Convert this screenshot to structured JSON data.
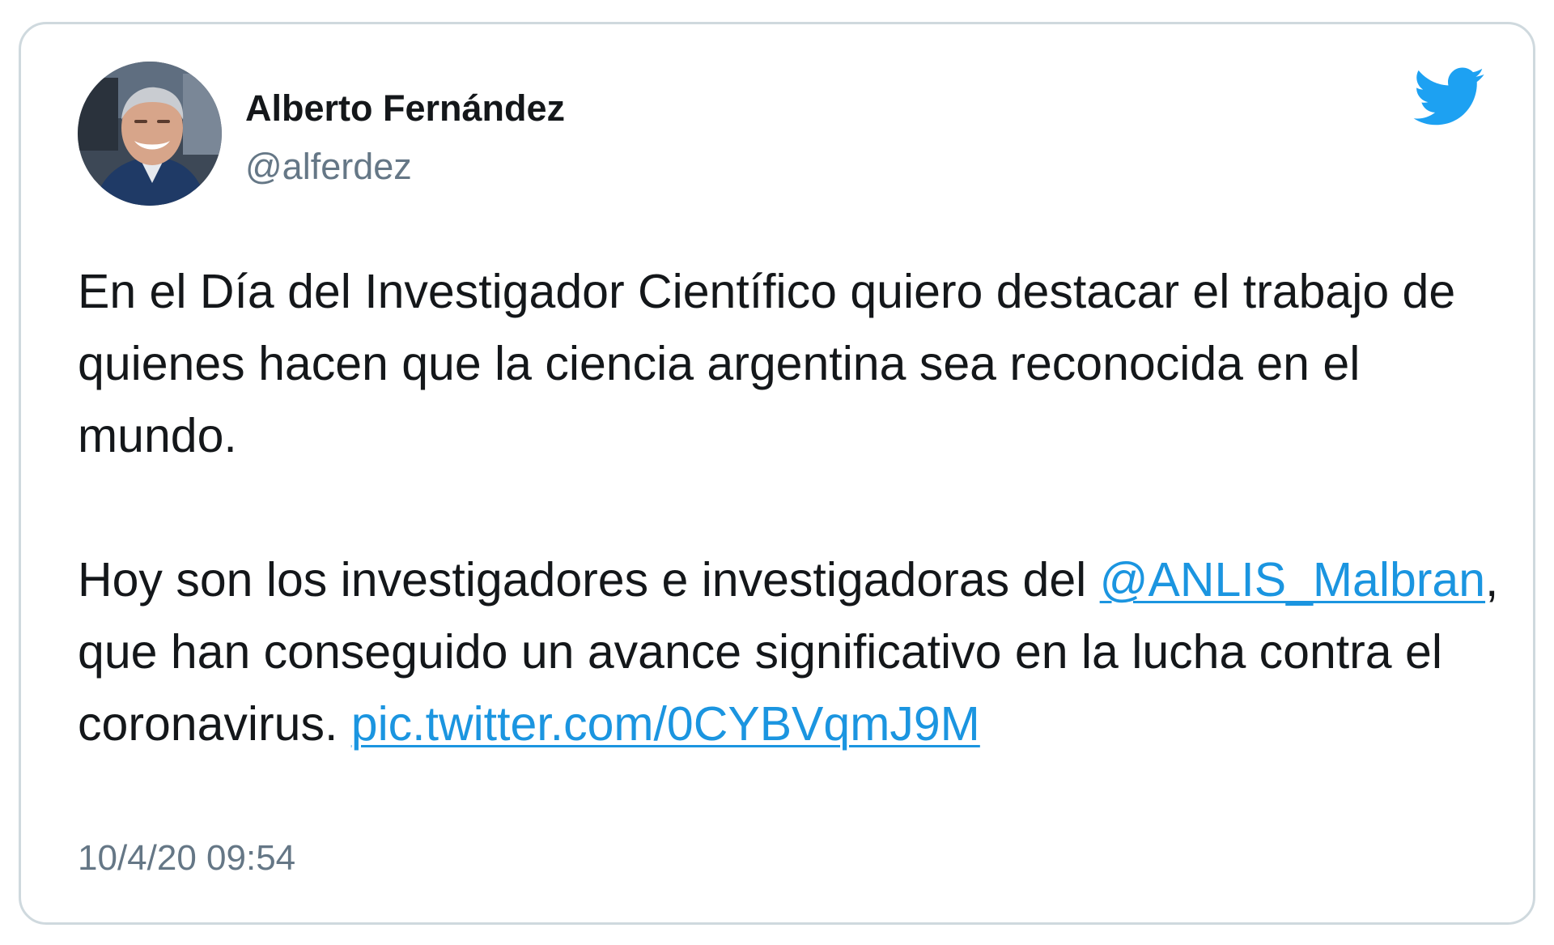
{
  "tweet": {
    "author": {
      "display_name": "Alberto Fernández",
      "handle": "@alferdez",
      "avatar_icon": "profile-photo-avatar"
    },
    "platform_icon": "twitter-bird-icon",
    "paragraph1": "En el Día del Investigador Científico quiero destacar el trabajo de quienes hacen que la ciencia argentina sea reconocida en el mundo.",
    "paragraph2_intro": "Hoy son los investigadores e investigadoras del ",
    "mention": "@ANLIS_Malbran",
    "paragraph2_rest": ", que han conseguido un avance significativo en la lucha contra el coronavirus. ",
    "media_link": "pic.twitter.com/0CYBVqmJ9M",
    "timestamp": "10/4/20 09:54"
  },
  "colors": {
    "text": "#14171a",
    "secondary_text": "#657786",
    "link": "#1b95e0",
    "twitter_blue": "#1da1f2",
    "card_border": "#cfd9de"
  }
}
